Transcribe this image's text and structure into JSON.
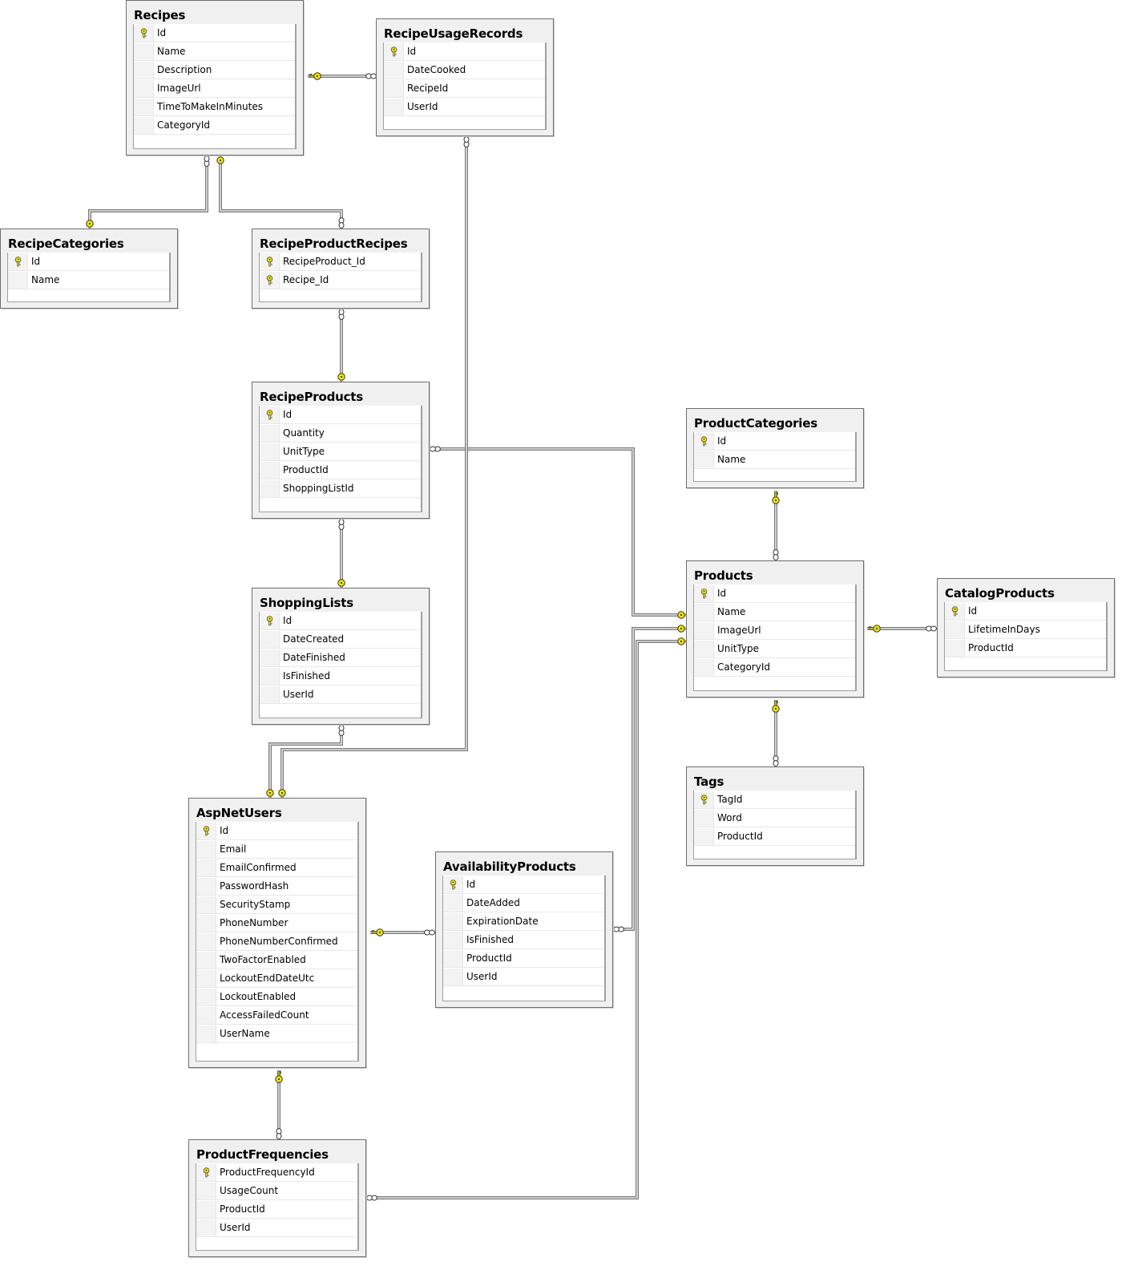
{
  "diagram": {
    "type": "database-er-diagram",
    "colors": {
      "key_yellow": "#f2e600",
      "table_bg": "#f0f0f0",
      "border": "#6e6e6e",
      "wire": "#7a7a7a"
    },
    "tables": {
      "recipes": {
        "name": "Recipes",
        "columns": [
          {
            "name": "Id",
            "pk": true
          },
          {
            "name": "Name"
          },
          {
            "name": "Description"
          },
          {
            "name": "ImageUrl"
          },
          {
            "name": "TimeToMakeInMinutes"
          },
          {
            "name": "CategoryId"
          }
        ]
      },
      "recipeUsageRecords": {
        "name": "RecipeUsageRecords",
        "columns": [
          {
            "name": "Id",
            "pk": true
          },
          {
            "name": "DateCooked"
          },
          {
            "name": "RecipeId"
          },
          {
            "name": "UserId"
          }
        ]
      },
      "recipeCategories": {
        "name": "RecipeCategories",
        "columns": [
          {
            "name": "Id",
            "pk": true
          },
          {
            "name": "Name"
          }
        ]
      },
      "recipeProductRecipes": {
        "name": "RecipeProductRecipes",
        "columns": [
          {
            "name": "RecipeProduct_Id",
            "pk": true
          },
          {
            "name": "Recipe_Id",
            "pk": true
          }
        ]
      },
      "recipeProducts": {
        "name": "RecipeProducts",
        "columns": [
          {
            "name": "Id",
            "pk": true
          },
          {
            "name": "Quantity"
          },
          {
            "name": "UnitType"
          },
          {
            "name": "ProductId"
          },
          {
            "name": "ShoppingListId"
          }
        ]
      },
      "shoppingLists": {
        "name": "ShoppingLists",
        "columns": [
          {
            "name": "Id",
            "pk": true
          },
          {
            "name": "DateCreated"
          },
          {
            "name": "DateFinished"
          },
          {
            "name": "IsFinished"
          },
          {
            "name": "UserId"
          }
        ]
      },
      "aspNetUsers": {
        "name": "AspNetUsers",
        "columns": [
          {
            "name": "Id",
            "pk": true
          },
          {
            "name": "Email"
          },
          {
            "name": "EmailConfirmed"
          },
          {
            "name": "PasswordHash"
          },
          {
            "name": "SecurityStamp"
          },
          {
            "name": "PhoneNumber"
          },
          {
            "name": "PhoneNumberConfirmed"
          },
          {
            "name": "TwoFactorEnabled"
          },
          {
            "name": "LockoutEndDateUtc"
          },
          {
            "name": "LockoutEnabled"
          },
          {
            "name": "AccessFailedCount"
          },
          {
            "name": "UserName"
          }
        ]
      },
      "availabilityProducts": {
        "name": "AvailabilityProducts",
        "columns": [
          {
            "name": "Id",
            "pk": true
          },
          {
            "name": "DateAdded"
          },
          {
            "name": "ExpirationDate"
          },
          {
            "name": "IsFinished"
          },
          {
            "name": "ProductId"
          },
          {
            "name": "UserId"
          }
        ]
      },
      "productFrequencies": {
        "name": "ProductFrequencies",
        "columns": [
          {
            "name": "ProductFrequencyId",
            "pk": true
          },
          {
            "name": "UsageCount"
          },
          {
            "name": "ProductId"
          },
          {
            "name": "UserId"
          }
        ]
      },
      "productCategories": {
        "name": "ProductCategories",
        "columns": [
          {
            "name": "Id",
            "pk": true
          },
          {
            "name": "Name"
          }
        ]
      },
      "products": {
        "name": "Products",
        "columns": [
          {
            "name": "Id",
            "pk": true
          },
          {
            "name": "Name"
          },
          {
            "name": "ImageUrl"
          },
          {
            "name": "UnitType"
          },
          {
            "name": "CategoryId"
          }
        ]
      },
      "catalogProducts": {
        "name": "CatalogProducts",
        "columns": [
          {
            "name": "Id",
            "pk": true
          },
          {
            "name": "LifetimeInDays"
          },
          {
            "name": "ProductId"
          }
        ]
      },
      "tags": {
        "name": "Tags",
        "columns": [
          {
            "name": "TagId",
            "pk": true
          },
          {
            "name": "Word"
          },
          {
            "name": "ProductId"
          }
        ]
      }
    },
    "relationships": [
      {
        "one": "Recipes",
        "many": "RecipeUsageRecords"
      },
      {
        "one": "RecipeCategories",
        "many": "Recipes"
      },
      {
        "one": "Recipes",
        "many": "RecipeProductRecipes"
      },
      {
        "one": "RecipeProducts",
        "many": "RecipeProductRecipes"
      },
      {
        "one": "ShoppingLists",
        "many": "RecipeProducts"
      },
      {
        "one": "Products",
        "many": "RecipeProducts"
      },
      {
        "one": "AspNetUsers",
        "many": "ShoppingLists"
      },
      {
        "one": "AspNetUsers",
        "many": "RecipeUsageRecords"
      },
      {
        "one": "AspNetUsers",
        "many": "AvailabilityProducts"
      },
      {
        "one": "AspNetUsers",
        "many": "ProductFrequencies"
      },
      {
        "one": "Products",
        "many": "AvailabilityProducts"
      },
      {
        "one": "Products",
        "many": "ProductFrequencies"
      },
      {
        "one": "ProductCategories",
        "many": "Products"
      },
      {
        "one": "Products",
        "many": "CatalogProducts"
      },
      {
        "one": "Products",
        "many": "Tags"
      }
    ]
  }
}
